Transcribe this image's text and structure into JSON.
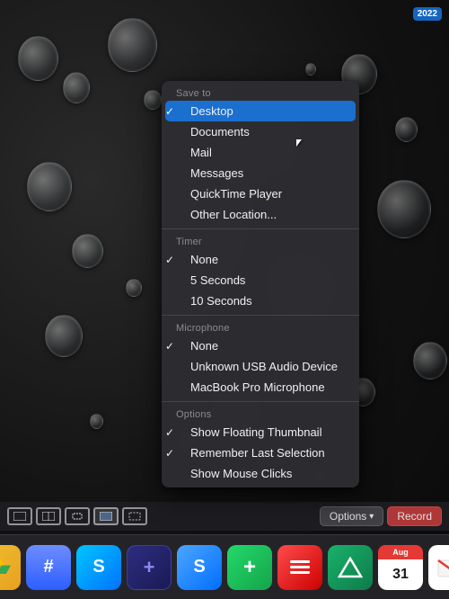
{
  "menubar": {
    "year_label": "2022"
  },
  "context_menu": {
    "save_to_label": "Save to",
    "items_save": [
      {
        "id": "desktop",
        "label": "Desktop",
        "checked": true,
        "highlighted": true
      },
      {
        "id": "documents",
        "label": "Documents",
        "checked": false,
        "highlighted": false
      },
      {
        "id": "mail",
        "label": "Mail",
        "checked": false,
        "highlighted": false
      },
      {
        "id": "messages",
        "label": "Messages",
        "checked": false,
        "highlighted": false
      },
      {
        "id": "quicktime",
        "label": "QuickTime Player",
        "checked": false,
        "highlighted": false
      },
      {
        "id": "other",
        "label": "Other Location...",
        "checked": false,
        "highlighted": false
      }
    ],
    "timer_label": "Timer",
    "items_timer": [
      {
        "id": "none",
        "label": "None",
        "checked": true
      },
      {
        "id": "5s",
        "label": "5 Seconds",
        "checked": false
      },
      {
        "id": "10s",
        "label": "10 Seconds",
        "checked": false
      }
    ],
    "microphone_label": "Microphone",
    "items_mic": [
      {
        "id": "none",
        "label": "None",
        "checked": true
      },
      {
        "id": "usb",
        "label": "Unknown USB Audio Device",
        "checked": false
      },
      {
        "id": "macbook",
        "label": "MacBook Pro Microphone",
        "checked": false
      }
    ],
    "options_label": "Options",
    "items_options": [
      {
        "id": "floating",
        "label": "Show Floating Thumbnail",
        "checked": true
      },
      {
        "id": "remember",
        "label": "Remember Last Selection",
        "checked": true
      },
      {
        "id": "mouse",
        "label": "Show Mouse Clicks",
        "checked": false
      }
    ]
  },
  "bottom_bar": {
    "options_label": "Options",
    "record_label": "Record"
  },
  "dock": {
    "icons": [
      {
        "id": "drive",
        "label": "Google Drive",
        "emoji": "▲"
      },
      {
        "id": "calendar",
        "label": "Calendar",
        "top": "Aug",
        "bottom": "31"
      },
      {
        "id": "slack",
        "label": "Slack",
        "emoji": "#"
      },
      {
        "id": "safari",
        "label": "Safari",
        "emoji": "S"
      },
      {
        "id": "setapp",
        "label": "Setapp",
        "emoji": "+"
      },
      {
        "id": "gmail",
        "label": "Gmail",
        "emoji": "M"
      }
    ]
  }
}
